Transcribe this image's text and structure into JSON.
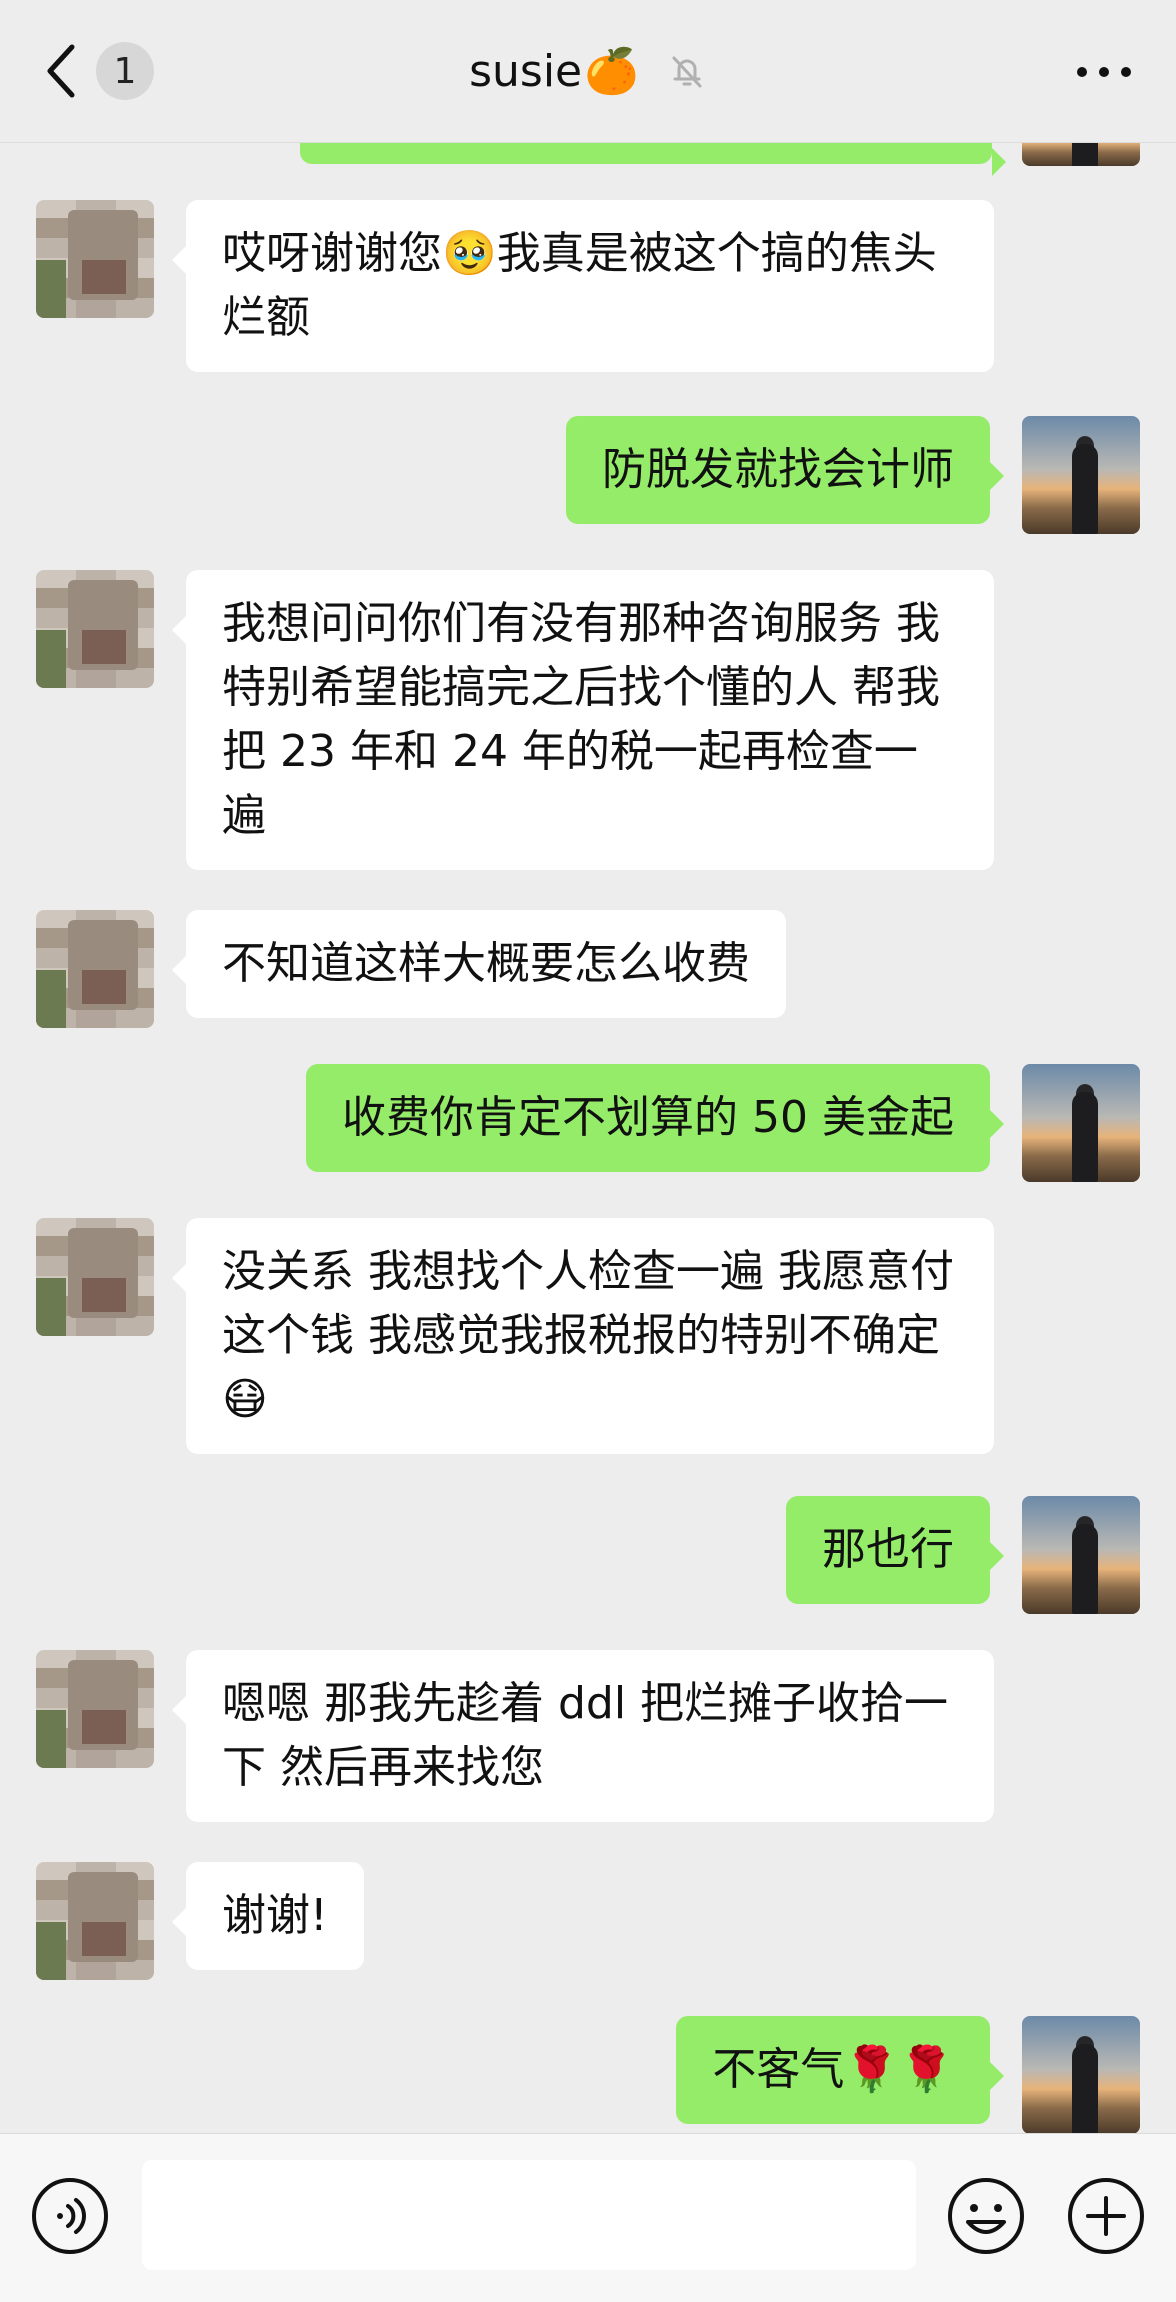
{
  "header": {
    "back_count": "1",
    "title": "susie",
    "title_emoji": "🍊",
    "mute_icon": "bell-muted-icon",
    "more_icon": "more-dots-icon"
  },
  "messages": [
    {
      "from": "me",
      "text": ""
    },
    {
      "from": "them",
      "text": "哎呀谢谢您🥹我真是被这个搞的焦头烂额"
    },
    {
      "from": "me",
      "text": "防脱发就找会计师"
    },
    {
      "from": "them",
      "text": "我想问问你们有没有那种咨询服务 我特别希望能搞完之后找个懂的人 帮我把 23 年和 24 年的税一起再检查一遍"
    },
    {
      "from": "them",
      "text": "不知道这样大概要怎么收费"
    },
    {
      "from": "me",
      "text": "收费你肯定不划算的 50 美金起"
    },
    {
      "from": "them",
      "text": "没关系 我想找个人检查一遍 我愿意付这个钱 我感觉我报税报的特别不确定😷"
    },
    {
      "from": "me",
      "text": "那也行"
    },
    {
      "from": "them",
      "text": "嗯嗯 那我先趁着 ddl 把烂摊子收拾一下 然后再来找您"
    },
    {
      "from": "them",
      "text": "谢谢!"
    },
    {
      "from": "me",
      "text": "不客气🌹🌹"
    }
  ],
  "footer": {
    "input_value": "",
    "voice_icon": "voice-icon",
    "emoji_icon": "smiley-icon",
    "plus_icon": "plus-icon"
  },
  "colors": {
    "background": "#ededed",
    "bubble_out": "#95ec69",
    "bubble_in": "#ffffff"
  }
}
